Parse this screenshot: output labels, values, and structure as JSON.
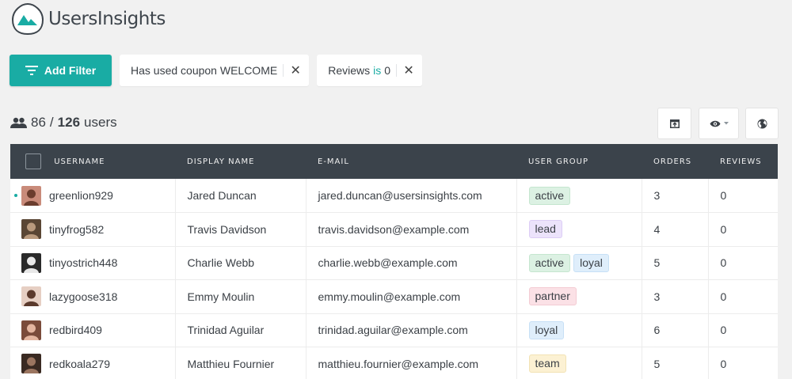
{
  "app": {
    "name": "UsersInsights"
  },
  "toolbar": {
    "add_filter_label": "Add Filter"
  },
  "filters": [
    {
      "text": "Has used coupon WELCOME"
    },
    {
      "before": "Reviews",
      "operator": "is",
      "value": "0"
    }
  ],
  "summary": {
    "filtered": "86",
    "separator": "/",
    "total": "126",
    "unit": "users"
  },
  "colors": {
    "accent": "#19aca4",
    "header_bg": "#3b434b"
  },
  "table": {
    "columns": [
      "Username",
      "Display Name",
      "E-mail",
      "User Group",
      "Orders",
      "Reviews"
    ],
    "rows": [
      {
        "username": "greenlion929",
        "display_name": "Jared Duncan",
        "email": "jared.duncan@usersinsights.com",
        "groups": [
          "active"
        ],
        "orders": "3",
        "reviews": "0",
        "online": true
      },
      {
        "username": "tinyfrog582",
        "display_name": "Travis Davidson",
        "email": "travis.davidson@example.com",
        "groups": [
          "lead"
        ],
        "orders": "4",
        "reviews": "0"
      },
      {
        "username": "tinyostrich448",
        "display_name": "Charlie Webb",
        "email": "charlie.webb@example.com",
        "groups": [
          "active",
          "loyal"
        ],
        "orders": "5",
        "reviews": "0"
      },
      {
        "username": "lazygoose318",
        "display_name": "Emmy Moulin",
        "email": "emmy.moulin@example.com",
        "groups": [
          "partner"
        ],
        "orders": "3",
        "reviews": "0"
      },
      {
        "username": "redbird409",
        "display_name": "Trinidad Aguilar",
        "email": "trinidad.aguilar@example.com",
        "groups": [
          "loyal"
        ],
        "orders": "6",
        "reviews": "0"
      },
      {
        "username": "redkoala279",
        "display_name": "Matthieu Fournier",
        "email": "matthieu.fournier@example.com",
        "groups": [
          "team"
        ],
        "orders": "5",
        "reviews": "0"
      }
    ]
  }
}
